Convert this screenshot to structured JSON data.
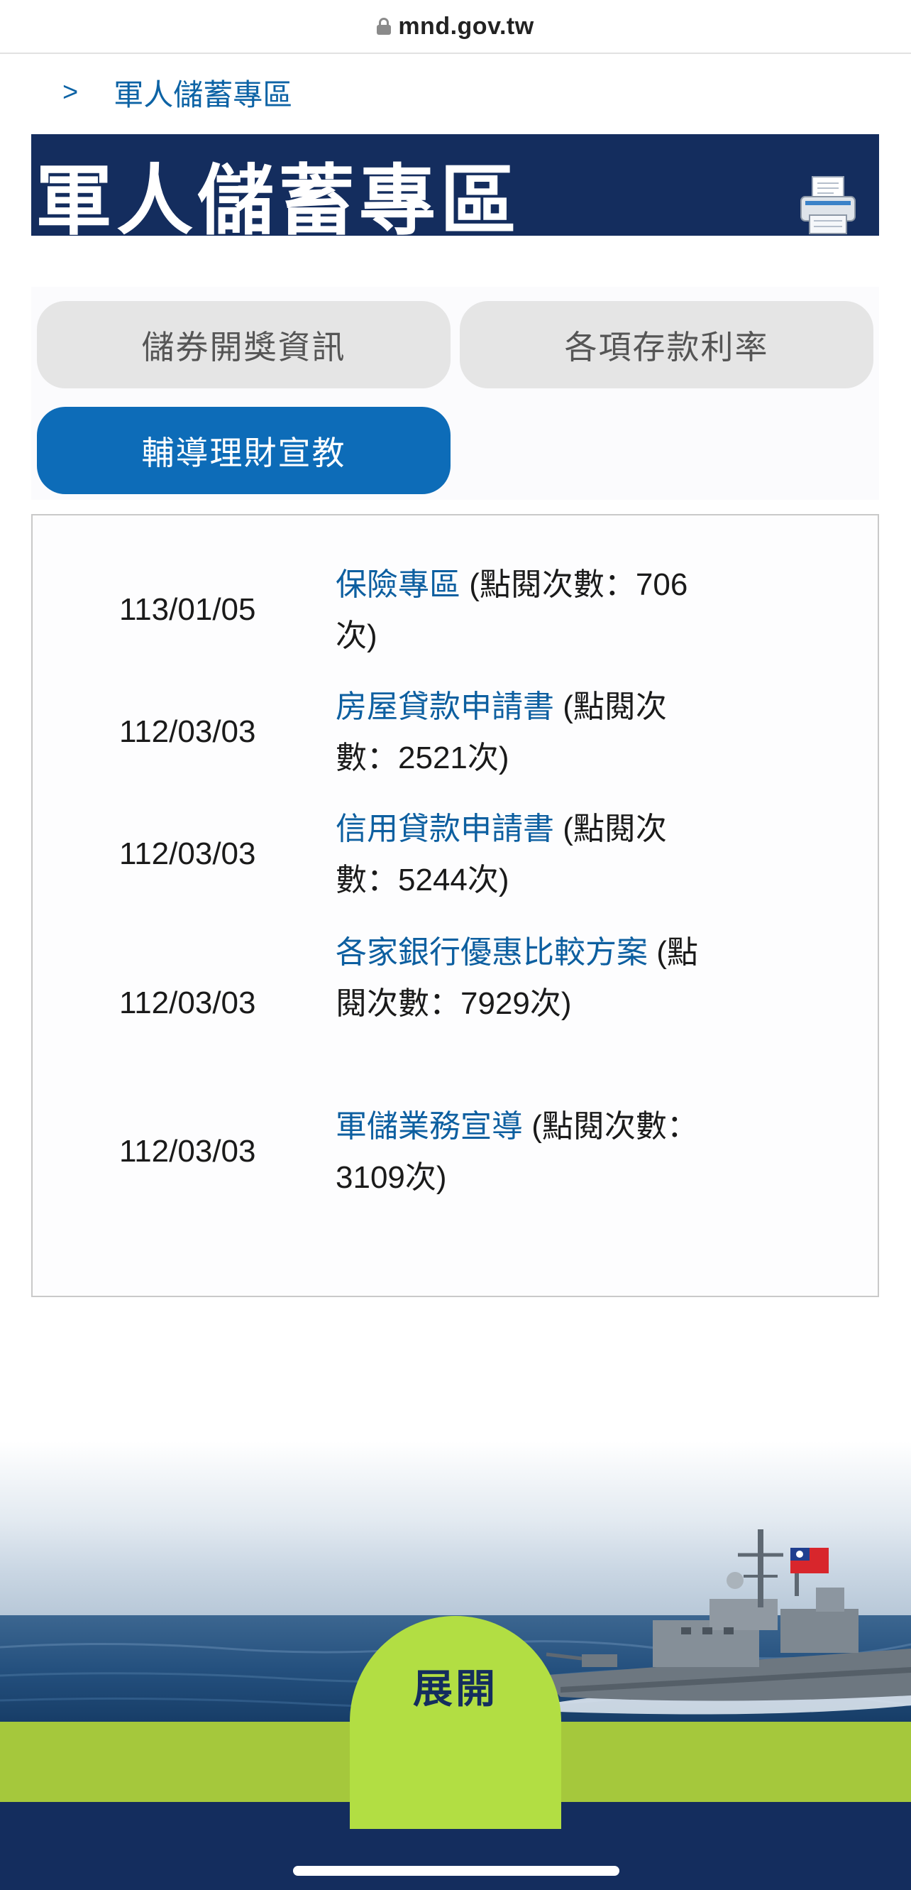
{
  "browser": {
    "url": "mnd.gov.tw"
  },
  "breadcrumb": {
    "separator": ">",
    "current": "軍人儲蓄專區"
  },
  "page": {
    "title": "軍人儲蓄專區"
  },
  "tabs": [
    {
      "label": "儲券開獎資訊",
      "active": false
    },
    {
      "label": "各項存款利率",
      "active": false
    },
    {
      "label": "輔導理財宣教",
      "active": true
    }
  ],
  "items": [
    {
      "date": "113/01/05",
      "title": "保險專區",
      "views_prefix": " (點閱次數：",
      "views": "706",
      "views_suffix": "次)"
    },
    {
      "date": "112/03/03",
      "title": "房屋貸款申請書",
      "views_prefix": " (點閱次數：",
      "views": "2521",
      "views_suffix": "次)"
    },
    {
      "date": "112/03/03",
      "title": "信用貸款申請書",
      "views_prefix": " (點閱次數：",
      "views": "5244",
      "views_suffix": "次)"
    },
    {
      "date": "112/03/03",
      "title": "各家銀行優惠比較方案",
      "views_prefix": " (點閱次數：",
      "views": "7929",
      "views_suffix": "次)"
    },
    {
      "date": "112/03/03",
      "title": "軍儲業務宣導",
      "views_prefix": " (點閱次數：",
      "views": "3109",
      "views_suffix": "次)"
    }
  ],
  "footer": {
    "expand_label": "展開"
  },
  "icons": {
    "lock": "lock-icon",
    "printer": "printer-icon",
    "warship": "warship-image",
    "flag": "flag-icon"
  },
  "colors": {
    "navy": "#142d5e",
    "link": "#0d5fa0",
    "active_tab": "#0d6cb8",
    "green": "#a5c83c",
    "expand": "#b2de43"
  }
}
